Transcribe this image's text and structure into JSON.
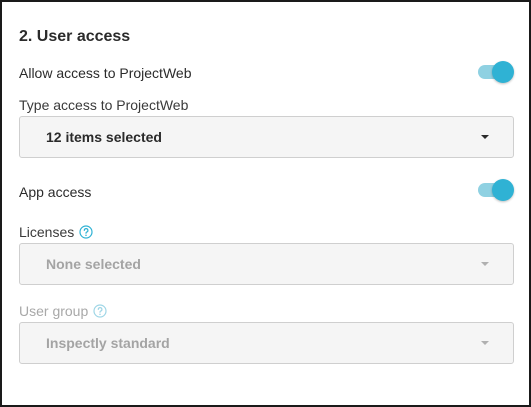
{
  "section": {
    "title": "2. User access"
  },
  "allow_access": {
    "label": "Allow access to ProjectWeb",
    "toggle_on": true
  },
  "type_access": {
    "label": "Type access to ProjectWeb",
    "value": "12 items selected"
  },
  "app_access": {
    "label": "App access",
    "toggle_on": true
  },
  "licenses": {
    "label": "Licenses",
    "value": "None selected",
    "icon": "help-icon"
  },
  "user_group": {
    "label": "User group",
    "value": "Inspectly standard",
    "icon": "help-icon"
  },
  "colors": {
    "accent": "#2fb2d4",
    "accent_track": "#8fd1e2",
    "field_bg": "#f5f5f5",
    "disabled_text": "#a8a8a8"
  }
}
